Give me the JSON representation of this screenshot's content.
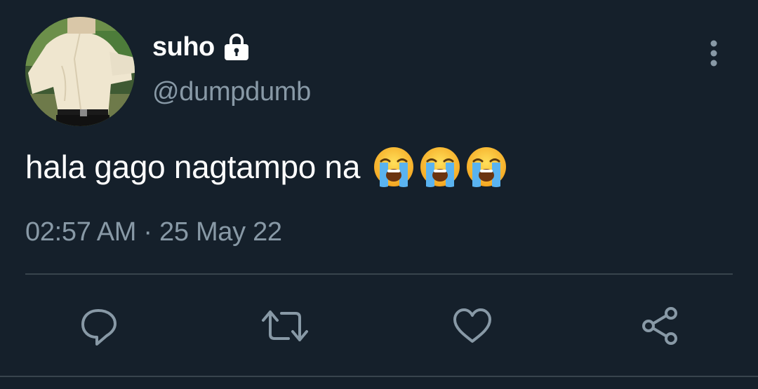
{
  "user": {
    "display_name": "suho",
    "handle": "@dumpdumb",
    "protected_icon": "lock-icon",
    "avatar_icon": "profile-photo"
  },
  "tweet": {
    "text": "hala gago nagtampo na",
    "emojis": [
      "loudly-crying-face",
      "loudly-crying-face",
      "loudly-crying-face"
    ],
    "timestamp": "02:57 AM · 25 May 22"
  },
  "actions": [
    {
      "name": "reply",
      "icon": "reply-bubble-icon"
    },
    {
      "name": "retweet",
      "icon": "retweet-icon"
    },
    {
      "name": "like",
      "icon": "heart-icon"
    },
    {
      "name": "share",
      "icon": "share-icon"
    }
  ],
  "menu_icon": "more-vertical-icon",
  "colors": {
    "background": "#15202b",
    "text_primary": "#ffffff",
    "text_secondary": "#8899a6",
    "icon": "#8899a6",
    "divider": "#38444d"
  }
}
